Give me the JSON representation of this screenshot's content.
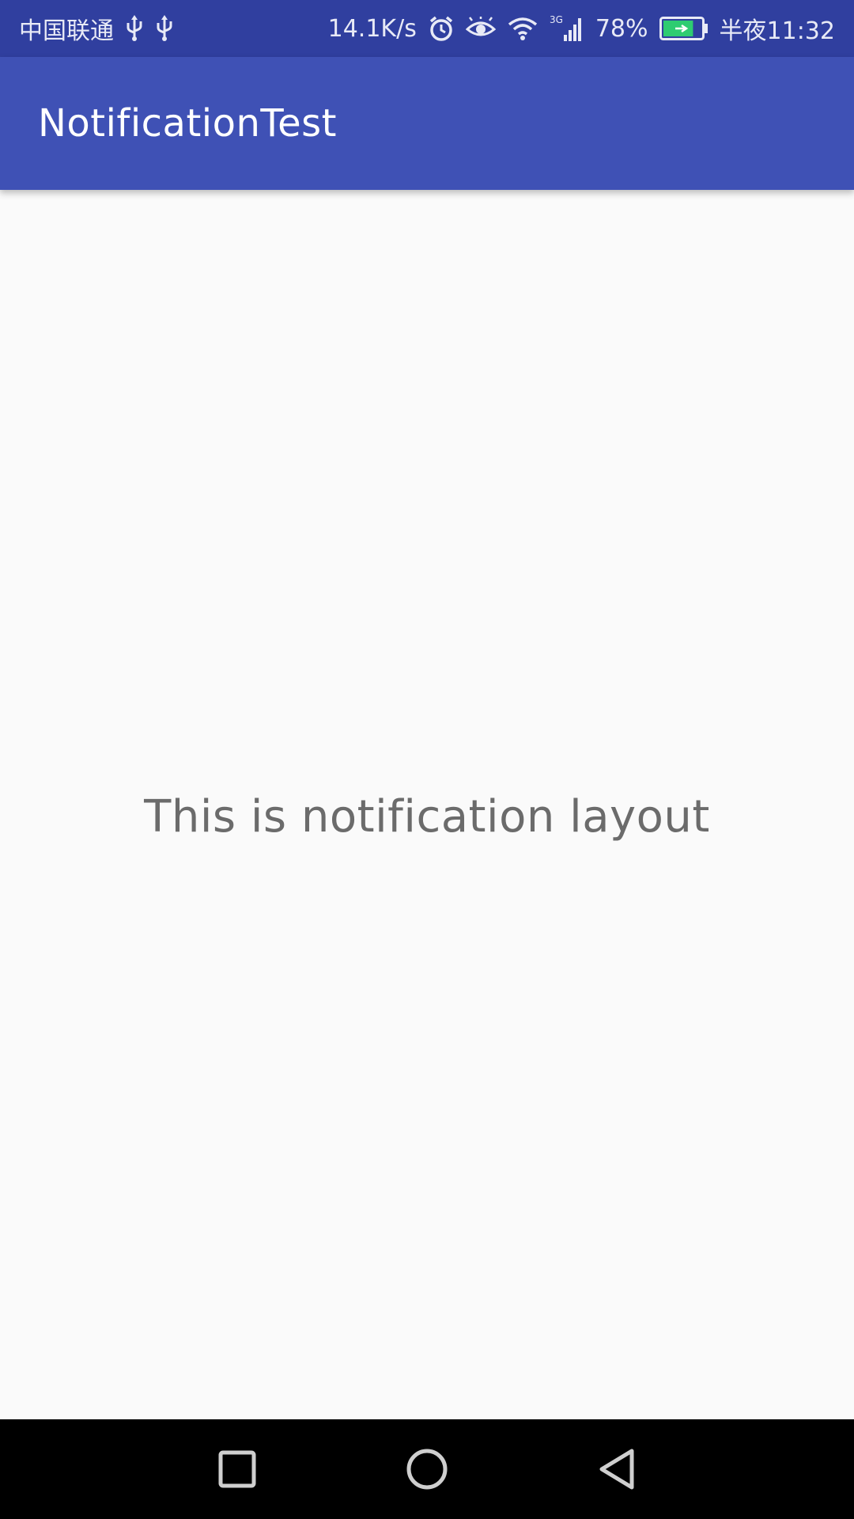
{
  "status_bar": {
    "carrier": "中国联通",
    "network_speed": "14.1K/s",
    "network_type": "3G",
    "battery_percent": "78%",
    "battery_level": 0.78,
    "time": "半夜11:32",
    "icons": [
      "usb-icon",
      "usb-icon",
      "alarm-icon",
      "eye-icon",
      "wifi-icon",
      "signal-icon",
      "battery-icon"
    ]
  },
  "app_bar": {
    "title": "NotificationTest"
  },
  "content": {
    "text": "This is notification layout"
  },
  "nav_bar": {
    "buttons": [
      "recents",
      "home",
      "back"
    ]
  },
  "colors": {
    "status_bar": "#303f9f",
    "app_bar": "#3f51b5",
    "background": "#fafafa",
    "text": "#6b6b6b",
    "battery_fill": "#2ecc71"
  }
}
